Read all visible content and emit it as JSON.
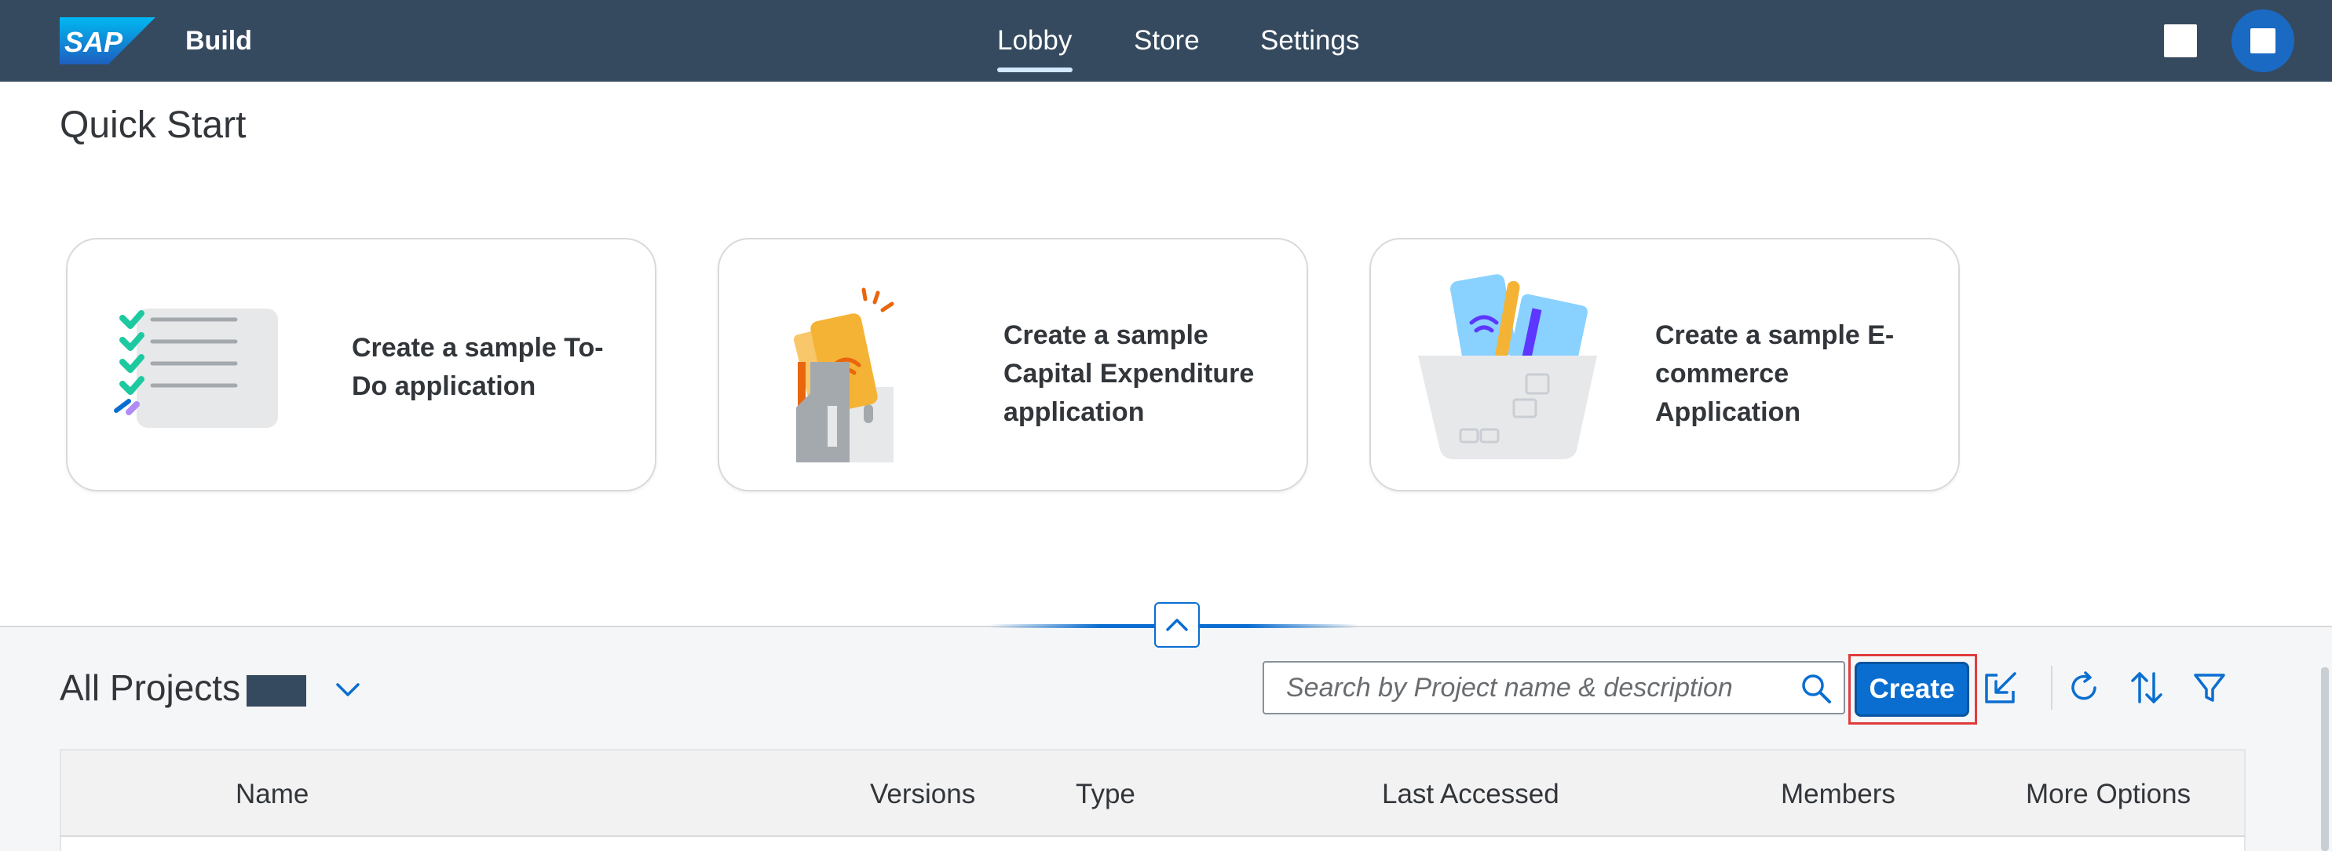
{
  "shell": {
    "logo_text": "SAP",
    "product_name": "Build",
    "nav": [
      {
        "label": "Lobby",
        "selected": true
      },
      {
        "label": "Store",
        "selected": false
      },
      {
        "label": "Settings",
        "selected": false
      }
    ]
  },
  "quick_start": {
    "title": "Quick Start",
    "cards": [
      {
        "lines": [
          "Create a sample To-",
          "Do application"
        ]
      },
      {
        "lines": [
          "Create a sample",
          "Capital Expenditure",
          "application"
        ]
      },
      {
        "lines": [
          "Create a sample E-",
          "commerce",
          "Application"
        ]
      }
    ]
  },
  "projects": {
    "title": "All Projects",
    "search": {
      "placeholder": "Search by Project name & description",
      "value": ""
    },
    "create_label": "Create",
    "columns": [
      "Name",
      "Versions",
      "Type",
      "Last Accessed",
      "Members",
      "More Options"
    ]
  },
  "colors": {
    "shell_bg": "#354a5f",
    "accent": "#0a6ed1",
    "highlight": "#e03c3c"
  }
}
